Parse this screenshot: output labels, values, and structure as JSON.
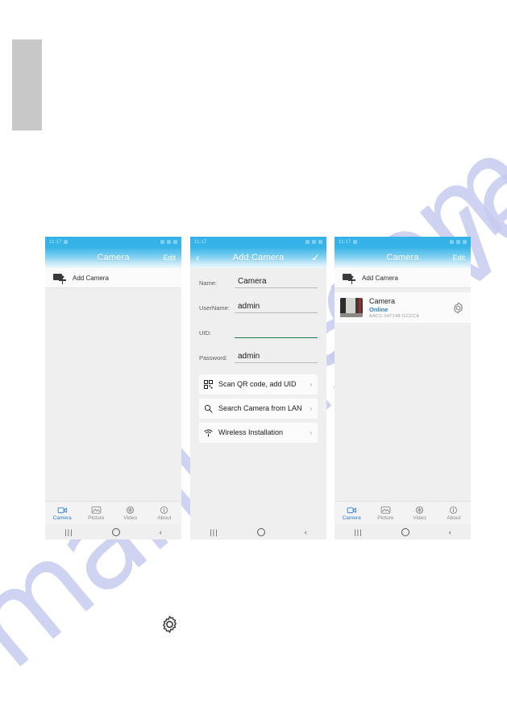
{
  "page": {
    "watermark_1": "manualshive",
    "watermark_2": ".com"
  },
  "phones": [
    {
      "id": "camera-list-empty",
      "statusbar": {
        "time": "11:17"
      },
      "appbar": {
        "title": "Camera",
        "right_action": "Edit"
      },
      "add_row": {
        "label": "Add Camera",
        "icon": "camera-plus-icon"
      },
      "cameras": [],
      "tabbar": [
        {
          "label": "Camera",
          "icon": "camera-icon",
          "active": true
        },
        {
          "label": "Picture",
          "icon": "picture-icon",
          "active": false
        },
        {
          "label": "Video",
          "icon": "video-icon",
          "active": false
        },
        {
          "label": "About",
          "icon": "info-icon",
          "active": false
        }
      ],
      "navbar": {
        "recent": "|||",
        "home": "home-circle-icon",
        "back": "‹"
      }
    },
    {
      "id": "add-camera-form",
      "statusbar": {
        "time": "11:17"
      },
      "appbar": {
        "title": "Add Camera",
        "left_action": "back-chevron-icon",
        "right_action": "checkmark-icon"
      },
      "form": [
        {
          "label": "Name:",
          "value": "Camera",
          "focused": false
        },
        {
          "label": "UserName:",
          "value": "admin",
          "focused": false
        },
        {
          "label": "UID:",
          "value": "",
          "focused": true
        },
        {
          "label": "Password:",
          "value": "admin",
          "focused": false
        }
      ],
      "actions": [
        {
          "label": "Scan QR code, add UID",
          "icon": "qr-code-icon",
          "chevron": "›"
        },
        {
          "label": "Search Camera from LAN",
          "icon": "search-icon",
          "chevron": "›"
        },
        {
          "label": "Wireless Installation",
          "icon": "wifi-icon",
          "chevron": "›"
        }
      ],
      "navbar": {
        "recent": "|||",
        "home": "home-circle-icon",
        "back": "‹"
      }
    },
    {
      "id": "camera-list-added",
      "statusbar": {
        "time": "11:17"
      },
      "appbar": {
        "title": "Camera",
        "right_action": "Edit"
      },
      "add_row": {
        "label": "Add Camera",
        "icon": "camera-plus-icon"
      },
      "cameras": [
        {
          "name": "Camera",
          "status": "Online",
          "uid": "AACC-047148-GCCCA",
          "settings_icon": "gear-icon"
        }
      ],
      "tabbar": [
        {
          "label": "Camera",
          "icon": "camera-icon",
          "active": true
        },
        {
          "label": "Picture",
          "icon": "picture-icon",
          "active": false
        },
        {
          "label": "Video",
          "icon": "video-icon",
          "active": false
        },
        {
          "label": "About",
          "icon": "info-icon",
          "active": false
        }
      ],
      "navbar": {
        "recent": "|||",
        "home": "home-circle-icon",
        "back": "‹"
      }
    }
  ],
  "caption": {
    "gear_icon": "gear-icon"
  },
  "colors": {
    "accent_blue": "#35b3e8",
    "status_online": "#2f7fd0",
    "focus_underline": "#1f7a4d",
    "watermark": "#c7ccf0"
  }
}
